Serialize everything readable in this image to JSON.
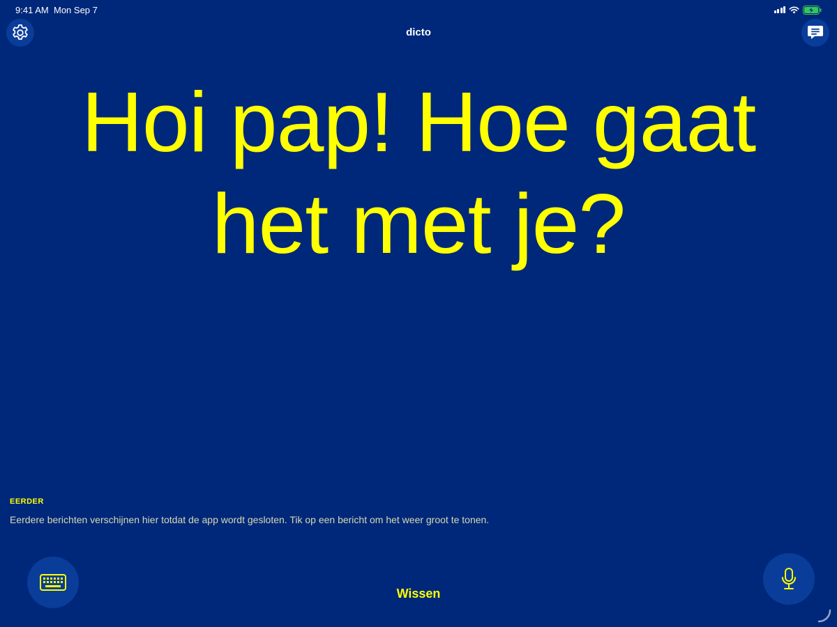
{
  "status_bar": {
    "time": "9:41 AM",
    "date": "Mon Sep 7"
  },
  "header": {
    "title": "dicto",
    "settings_icon": "gear-icon",
    "messages_icon": "chat-bubble-icon"
  },
  "main": {
    "message": "Hoi pap! Hoe gaat het met je?"
  },
  "history": {
    "heading": "EERDER",
    "hint": "Eerdere berichten verschijnen hier totdat de app wordt gesloten. Tik op een bericht om het weer groot te tonen."
  },
  "footer": {
    "clear_label": "Wissen",
    "keyboard_icon": "keyboard-icon",
    "mic_icon": "microphone-icon"
  },
  "colors": {
    "background": "#00287a",
    "accent": "#ffff00",
    "button": "#0a3d99",
    "battery": "#34c759"
  }
}
